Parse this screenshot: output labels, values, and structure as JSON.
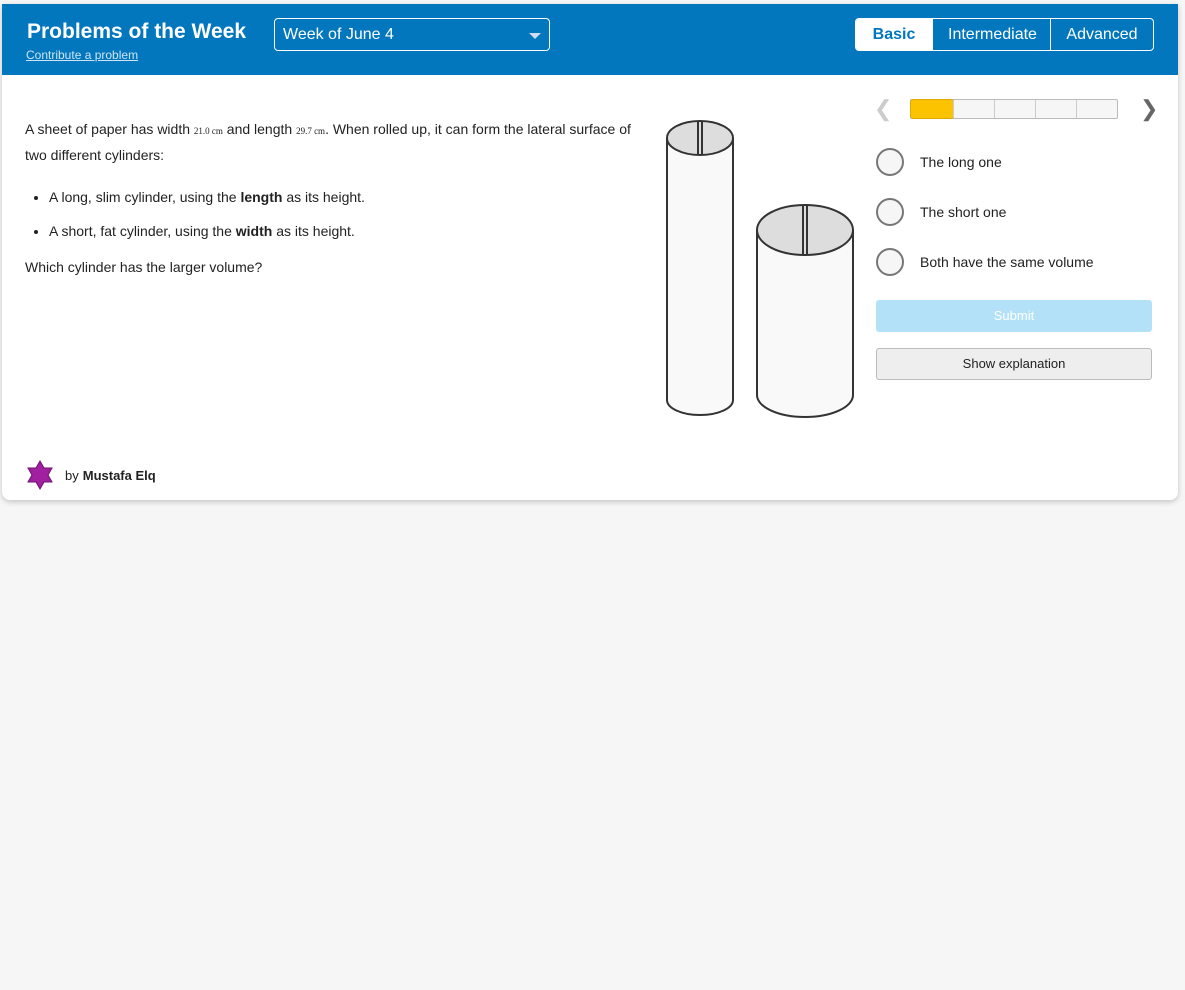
{
  "header": {
    "title": "Problems of the Week",
    "contribute": "Contribute a problem",
    "week": "Week of June 4",
    "levels": [
      "Basic",
      "Intermediate",
      "Advanced"
    ]
  },
  "problem": {
    "p1a": "A sheet of paper has width ",
    "width": "21.0 cm",
    "p1b": " and length ",
    "length": "29.7 cm",
    "p1c": ". When rolled up, it can form the lateral surface of two different cylinders:",
    "b1a": "A long, slim cylinder, using the ",
    "b1b": "length",
    "b1c": " as its height.",
    "b2a": "A short, fat cylinder, using the ",
    "b2b": "width",
    "b2c": " as its height.",
    "question": "Which cylinder has the larger volume?"
  },
  "progress": {
    "current": 1,
    "total": 5
  },
  "choices": [
    "The long one",
    "The short one",
    "Both have the same volume"
  ],
  "submit": "Submit",
  "explain": "Show explanation",
  "author": {
    "by": "by",
    "name": "Mustafa Elq"
  }
}
